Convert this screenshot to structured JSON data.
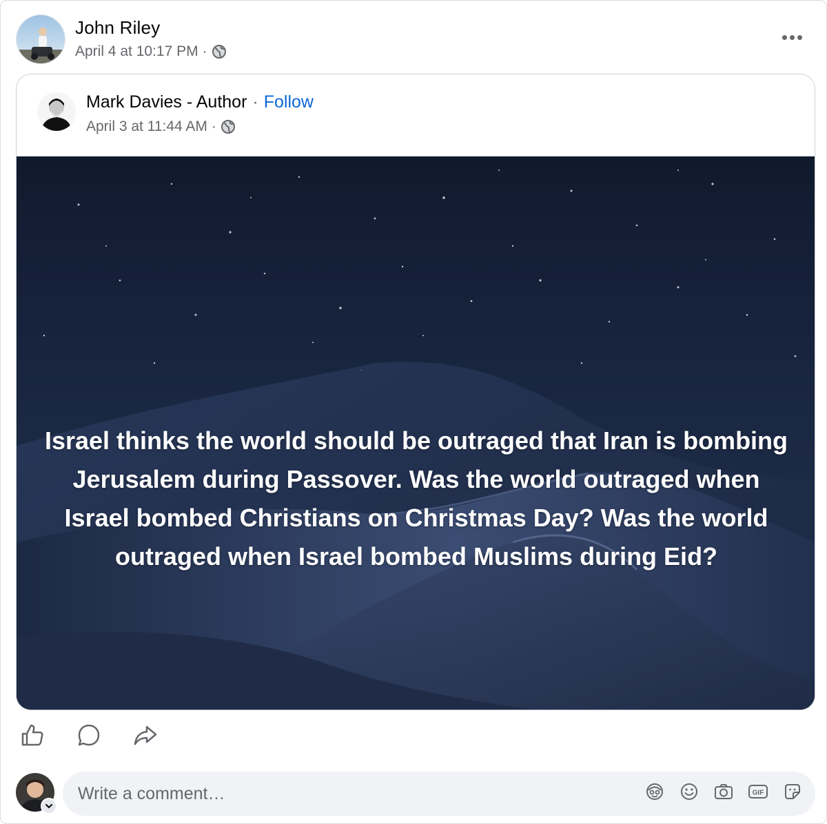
{
  "post": {
    "author": "John Riley",
    "timestamp": "April 4 at 10:17 PM",
    "meta_separator": "·",
    "privacy_icon": "globe-icon",
    "more_icon": "more-horizontal-icon"
  },
  "shared": {
    "author": "Mark Davies - Author",
    "name_separator": "·",
    "follow_label": "Follow",
    "timestamp": "April 3 at 11:44 AM",
    "meta_separator": "·",
    "privacy_icon": "globe-icon",
    "image_text": "Israel thinks the world should be outraged that Iran is bombing Jerusalem during Passover. Was the world outraged when Israel bombed Christians on Christmas Day? Was the world outraged when Israel bombed Muslims during Eid?"
  },
  "actions": {
    "icons": [
      "like-icon",
      "comment-icon",
      "share-icon"
    ]
  },
  "comment": {
    "placeholder": "Write a comment…",
    "icons": [
      "avatar-sticker-icon",
      "emoji-icon",
      "camera-icon",
      "gif-icon",
      "sticker-icon"
    ]
  },
  "colors": {
    "link": "#0a66d8",
    "meta_text": "#65676b",
    "comment_bg": "#f0f2f5",
    "image_bg": "#18233a"
  }
}
